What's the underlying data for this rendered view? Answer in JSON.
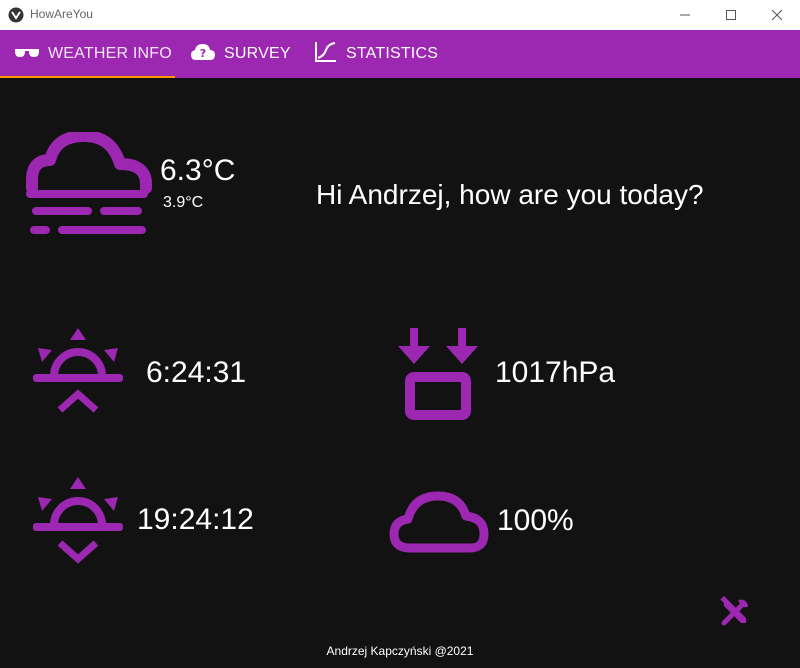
{
  "window": {
    "title": "HowAreYou",
    "minimize_icon": "minimize-icon",
    "maximize_icon": "maximize-icon",
    "close_icon": "close-icon"
  },
  "tabs": [
    {
      "label": "WEATHER INFO",
      "icon": "sunglasses-icon",
      "active": true
    },
    {
      "label": "SURVEY",
      "icon": "cloud-question-icon",
      "active": false
    },
    {
      "label": "STATISTICS",
      "icon": "chart-line-icon",
      "active": false
    }
  ],
  "weather": {
    "temperature": "6.3°C",
    "feels_like": "3.9°C",
    "condition_icon": "weather-fog-icon",
    "sunrise": "6:24:31",
    "sunset": "19:24:12",
    "pressure": "1017hPa",
    "cloudiness": "100%"
  },
  "greeting": "Hi Andrzej, how are you today?",
  "footer": "Andrzej Kapczyński @2021",
  "colors": {
    "accent": "#9c27b0",
    "tab_indicator": "#ff9800",
    "background": "#121212"
  }
}
